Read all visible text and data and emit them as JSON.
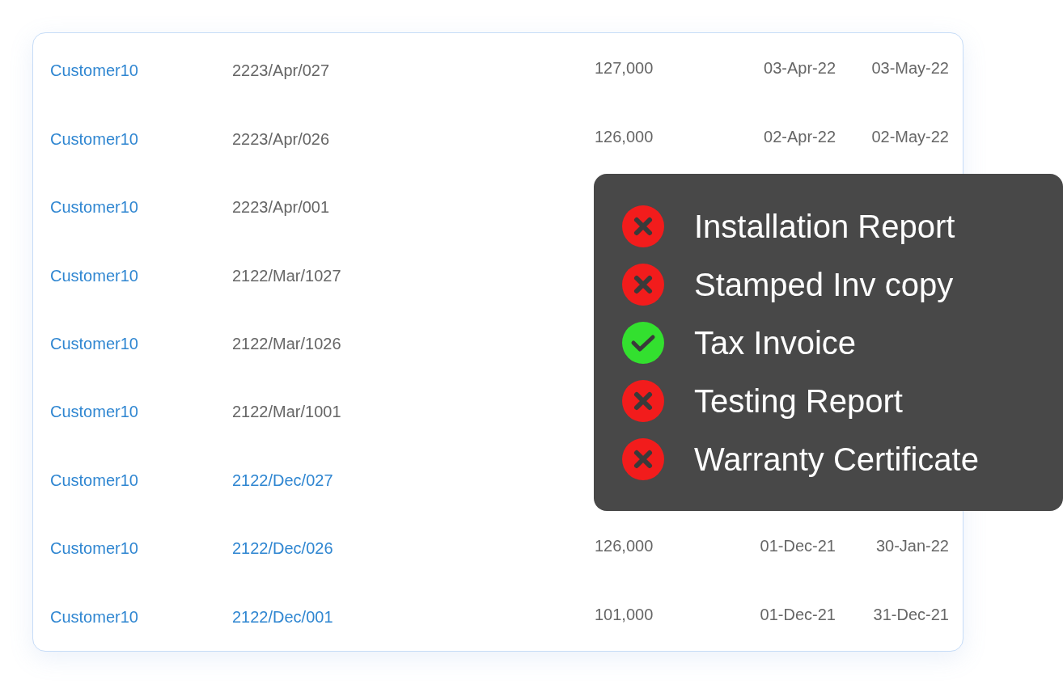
{
  "invoices": [
    {
      "customer": "Customer10",
      "invoice": "2223/Apr/027",
      "linked": false,
      "amount": "127,000",
      "date": "03-Apr-22",
      "due": "03-May-22"
    },
    {
      "customer": "Customer10",
      "invoice": "2223/Apr/026",
      "linked": false,
      "amount": "126,000",
      "date": "02-Apr-22",
      "due": "02-May-22"
    },
    {
      "customer": "Customer10",
      "invoice": "2223/Apr/001",
      "linked": false
    },
    {
      "customer": "Customer10",
      "invoice": "2122/Mar/1027",
      "linked": false
    },
    {
      "customer": "Customer10",
      "invoice": "2122/Mar/1026",
      "linked": false
    },
    {
      "customer": "Customer10",
      "invoice": "2122/Mar/1001",
      "linked": false
    },
    {
      "customer": "Customer10",
      "invoice": "2122/Dec/027",
      "linked": true
    },
    {
      "customer": "Customer10",
      "invoice": "2122/Dec/026",
      "linked": true,
      "amount": "126,000",
      "date": "01-Dec-21",
      "due": "30-Jan-22"
    },
    {
      "customer": "Customer10",
      "invoice": "2122/Dec/001",
      "linked": true,
      "amount": "101,000",
      "date": "01-Dec-21",
      "due": "31-Dec-21"
    }
  ],
  "documents_popover": {
    "items": [
      {
        "label": "Installation Report",
        "done": false
      },
      {
        "label": "Stamped Inv copy",
        "done": false
      },
      {
        "label": "Tax Invoice",
        "done": true
      },
      {
        "label": "Testing Report",
        "done": false
      },
      {
        "label": "Warranty Certificate",
        "done": false
      }
    ]
  }
}
